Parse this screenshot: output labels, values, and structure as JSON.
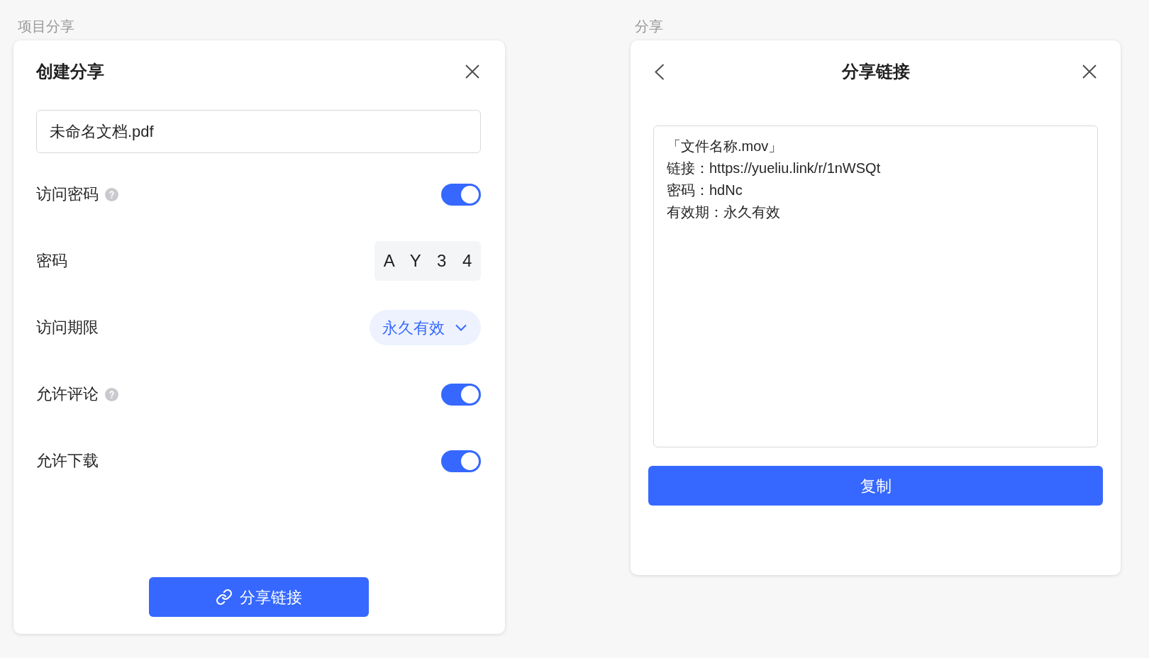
{
  "create_share": {
    "caption": "项目分享",
    "title": "创建分享",
    "file_name": "未命名文档.pdf",
    "settings": [
      {
        "kind": "toggle",
        "label": "访问密码",
        "help": true,
        "on": true
      },
      {
        "kind": "code",
        "label": "密码",
        "value": "A Y 3 4"
      },
      {
        "kind": "dropdown",
        "label": "访问期限",
        "value": "永久有效"
      },
      {
        "kind": "toggle",
        "label": "允许评论",
        "help": true,
        "on": true
      },
      {
        "kind": "toggle",
        "label": "允许下载",
        "help": false,
        "on": true
      }
    ],
    "button": "分享链接"
  },
  "share_link": {
    "caption": "分享",
    "title": "分享链接",
    "lines": [
      "「文件名称.mov」",
      "链接：https://yueliu.link/r/1nWSQt",
      "密码：hdNc",
      "有效期：永久有效"
    ],
    "button": "复制"
  }
}
